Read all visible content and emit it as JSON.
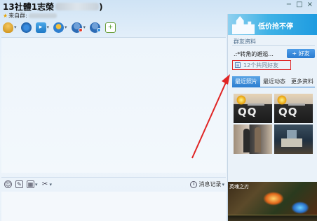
{
  "window": {
    "title": "13社體1志榮",
    "title_tail": ")",
    "subtitle_prefix": "来自群:",
    "controls": [
      "−",
      "□",
      "×"
    ]
  },
  "toolbar": {
    "icons": [
      "microphone-icon",
      "webcam-icon",
      "folder-icon",
      "app-icon",
      "remove-member-icon",
      "add-member-icon",
      "add-doc-icon"
    ]
  },
  "chat": {
    "history_label": "消息记录"
  },
  "side": {
    "banner_text": "低价抢不停",
    "section_title": "群友资料",
    "friend_name": ".:*转角的邂逅...",
    "add_friend_label": "+ 好友",
    "mutual_friends": "12个共同好友",
    "tabs": [
      "最近照片",
      "最近动态",
      "更多资料"
    ],
    "photo_labels": [
      "QQ",
      "QQ"
    ],
    "game_title": "英魂之刃"
  },
  "colors": {
    "accent": "#2e7fd1",
    "highlight": "#df2a2a",
    "banner": "#3fb2e6"
  }
}
